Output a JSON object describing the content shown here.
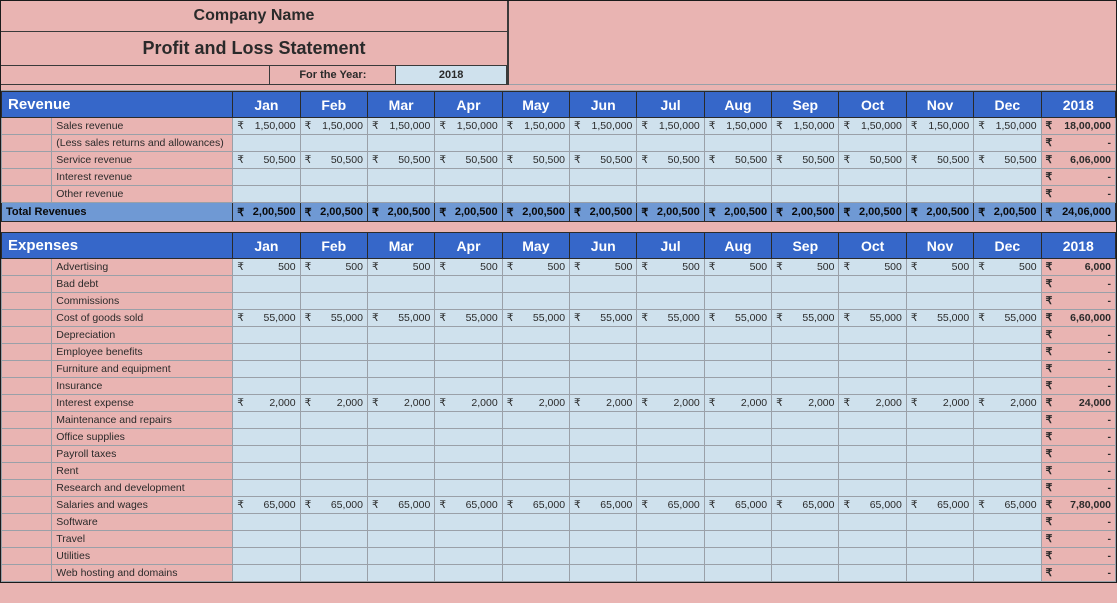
{
  "header": {
    "company": "Company Name",
    "subtitle": "Profit and Loss Statement",
    "for_year_label": "For the Year:",
    "year": "2018"
  },
  "currency": "₹",
  "months": [
    "Jan",
    "Feb",
    "Mar",
    "Apr",
    "May",
    "Jun",
    "Jul",
    "Aug",
    "Sep",
    "Oct",
    "Nov",
    "Dec"
  ],
  "year_col": "2018",
  "revenue": {
    "title": "Revenue",
    "rows": [
      {
        "label": "Sales revenue",
        "monthly": "1,50,000",
        "year": "18,00,000"
      },
      {
        "label": "(Less sales returns and allowances)",
        "monthly": "",
        "year": "-"
      },
      {
        "label": "Service revenue",
        "monthly": "50,500",
        "year": "6,06,000"
      },
      {
        "label": "Interest revenue",
        "monthly": "",
        "year": "-"
      },
      {
        "label": "Other revenue",
        "monthly": "",
        "year": "-"
      }
    ],
    "total_label": "Total Revenues",
    "total_monthly": "2,00,500",
    "total_year": "24,06,000"
  },
  "expenses": {
    "title": "Expenses",
    "rows": [
      {
        "label": "Advertising",
        "monthly": "500",
        "year": "6,000"
      },
      {
        "label": "Bad debt",
        "monthly": "",
        "year": "-"
      },
      {
        "label": "Commissions",
        "monthly": "",
        "year": "-"
      },
      {
        "label": "Cost of goods sold",
        "monthly": "55,000",
        "year": "6,60,000"
      },
      {
        "label": "Depreciation",
        "monthly": "",
        "year": "-"
      },
      {
        "label": "Employee benefits",
        "monthly": "",
        "year": "-"
      },
      {
        "label": "Furniture and equipment",
        "monthly": "",
        "year": "-"
      },
      {
        "label": "Insurance",
        "monthly": "",
        "year": "-"
      },
      {
        "label": "Interest expense",
        "monthly": "2,000",
        "year": "24,000"
      },
      {
        "label": "Maintenance and repairs",
        "monthly": "",
        "year": "-"
      },
      {
        "label": "Office supplies",
        "monthly": "",
        "year": "-"
      },
      {
        "label": "Payroll taxes",
        "monthly": "",
        "year": "-"
      },
      {
        "label": "Rent",
        "monthly": "",
        "year": "-"
      },
      {
        "label": "Research and development",
        "monthly": "",
        "year": "-"
      },
      {
        "label": "Salaries and wages",
        "monthly": "65,000",
        "year": "7,80,000"
      },
      {
        "label": "Software",
        "monthly": "",
        "year": "-"
      },
      {
        "label": "Travel",
        "monthly": "",
        "year": "-"
      },
      {
        "label": "Utilities",
        "monthly": "",
        "year": "-"
      },
      {
        "label": "Web hosting and domains",
        "monthly": "",
        "year": "-"
      }
    ]
  }
}
